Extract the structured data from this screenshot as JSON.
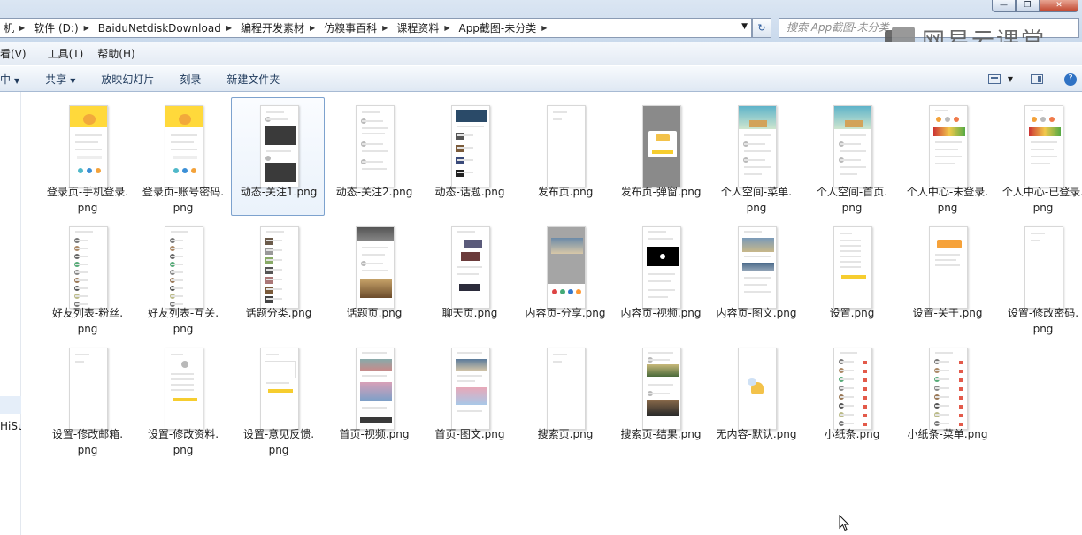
{
  "window": {
    "min_label": "—",
    "max_label": "❐",
    "close_label": "✕"
  },
  "address": {
    "crumbs": [
      "机",
      "软件 (D:)",
      "BaiduNetdiskDownload",
      "编程开发素材",
      "仿糗事百科",
      "课程资料",
      "App截图-未分类"
    ],
    "dropdown_icon": "▼",
    "refresh_icon": "↻"
  },
  "search": {
    "placeholder": "搜索 App截图-未分类"
  },
  "watermark": {
    "text": "网易云课堂",
    "logo_icon": "netease-cloud-classroom-logo"
  },
  "menu": {
    "items": [
      "看(V)",
      "工具(T)",
      "帮助(H)"
    ]
  },
  "toolbar": {
    "items": [
      {
        "label": "中",
        "caret": "▼"
      },
      {
        "label": "共享",
        "caret": "▼"
      },
      {
        "label": "放映幻灯片",
        "caret": ""
      },
      {
        "label": "刻录",
        "caret": ""
      },
      {
        "label": "新建文件夹",
        "caret": ""
      }
    ],
    "help_label": "?"
  },
  "navpane": {
    "partial_label": "HiSu"
  },
  "files": [
    {
      "name": "登录页-手机登录.\npng",
      "thumb": "login"
    },
    {
      "name": "登录页-账号密码.\npng",
      "thumb": "login"
    },
    {
      "name": "动态-关注1.png",
      "thumb": "feed-video",
      "selected": true
    },
    {
      "name": "动态-关注2.png",
      "thumb": "feed"
    },
    {
      "name": "动态-话题.png",
      "thumb": "topic"
    },
    {
      "name": "发布页.png",
      "thumb": "blank"
    },
    {
      "name": "发布页-弹窗.png",
      "thumb": "grey-dialog"
    },
    {
      "name": "个人空间-菜单.\npng",
      "thumb": "space"
    },
    {
      "name": "个人空间-首页.\npng",
      "thumb": "space"
    },
    {
      "name": "个人中心-未登录.\npng",
      "thumb": "center"
    },
    {
      "name": "个人中心-已登录.\npng",
      "thumb": "center"
    },
    {
      "name": "好友列表-粉丝.\npng",
      "thumb": "list"
    },
    {
      "name": "好友列表-互关.\npng",
      "thumb": "list"
    },
    {
      "name": "话题分类.png",
      "thumb": "topic-list"
    },
    {
      "name": "话题页.png",
      "thumb": "topic-page"
    },
    {
      "name": "聊天页.png",
      "thumb": "chat"
    },
    {
      "name": "内容页-分享.png",
      "thumb": "share"
    },
    {
      "name": "内容页-视频.png",
      "thumb": "video"
    },
    {
      "name": "内容页-图文.png",
      "thumb": "article"
    },
    {
      "name": "设置.png",
      "thumb": "settings"
    },
    {
      "name": "设置-关于.png",
      "thumb": "about"
    },
    {
      "name": "设置-修改密码.\npng",
      "thumb": "blank"
    },
    {
      "name": "设置-修改邮箱.\npng",
      "thumb": "blank"
    },
    {
      "name": "设置-修改资料.\npng",
      "thumb": "profile"
    },
    {
      "name": "设置-意见反馈.\npng",
      "thumb": "feedback"
    },
    {
      "name": "首页-视频.png",
      "thumb": "home-video"
    },
    {
      "name": "首页-图文.png",
      "thumb": "home-article"
    },
    {
      "name": "搜索页.png",
      "thumb": "blank"
    },
    {
      "name": "搜索页-结果.png",
      "thumb": "search-result"
    },
    {
      "name": "无内容-默认.png",
      "thumb": "empty"
    },
    {
      "name": "小纸条.png",
      "thumb": "notes"
    },
    {
      "name": "小纸条-菜单.png",
      "thumb": "notes"
    }
  ]
}
